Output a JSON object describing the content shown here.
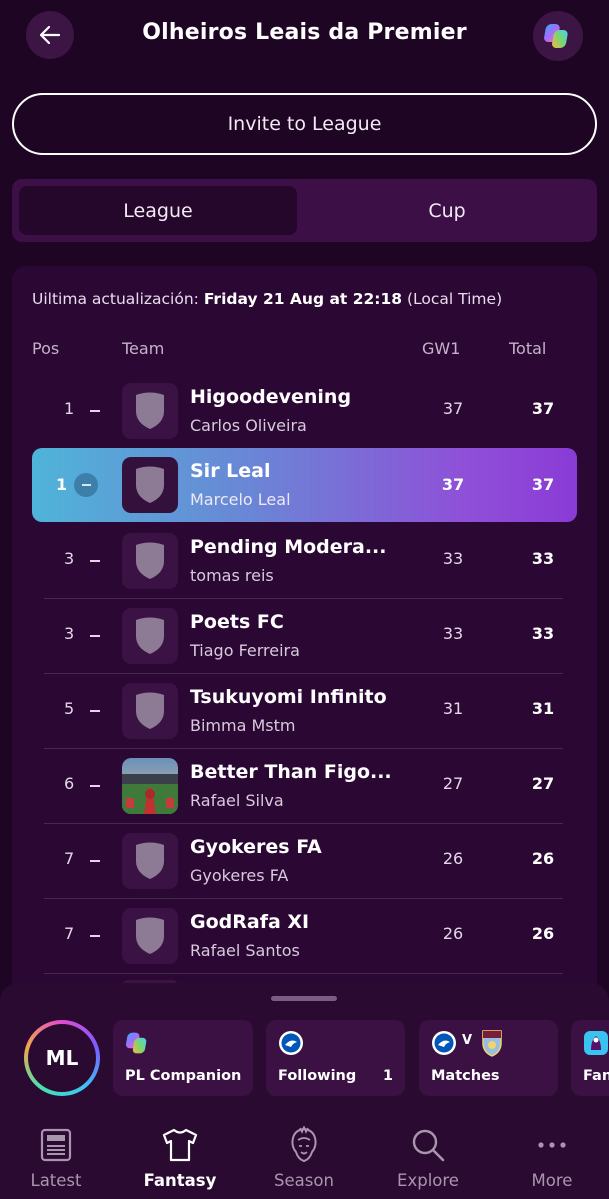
{
  "header": {
    "title": "Olheiros Leais da Premier",
    "back_icon": "arrow-left-icon",
    "assistant_icon": "copilot-icon"
  },
  "invite": {
    "label": "Invite to League"
  },
  "tabs": [
    {
      "label": "League",
      "active": true
    },
    {
      "label": "Cup",
      "active": false
    }
  ],
  "standings": {
    "updated_prefix": "Uiltima actualización: ",
    "updated_value": "Friday 21 Aug at 22:18",
    "updated_suffix": " (Local Time)",
    "columns": {
      "pos": "Pos",
      "team": "Team",
      "gw": "GW1",
      "total": "Total"
    },
    "rows": [
      {
        "pos": "1",
        "team": "Higoodevening",
        "manager": "Carlos Oliveira",
        "gw": "37",
        "total": "37",
        "highlight": false,
        "crest": "shield"
      },
      {
        "pos": "1",
        "team": "Sir Leal",
        "manager": "Marcelo Leal",
        "gw": "37",
        "total": "37",
        "highlight": true,
        "crest": "shield"
      },
      {
        "pos": "3",
        "team": "Pending Modera...",
        "manager": "tomas reis",
        "gw": "33",
        "total": "33",
        "highlight": false,
        "crest": "shield"
      },
      {
        "pos": "3",
        "team": "Poets FC",
        "manager": "Tiago Ferreira",
        "gw": "33",
        "total": "33",
        "highlight": false,
        "crest": "shield"
      },
      {
        "pos": "5",
        "team": "Tsukuyomi Infinito",
        "manager": "Bimma Mstm",
        "gw": "31",
        "total": "31",
        "highlight": false,
        "crest": "shield"
      },
      {
        "pos": "6",
        "team": "Better Than Figo...",
        "manager": "Rafael Silva",
        "gw": "27",
        "total": "27",
        "highlight": false,
        "crest": "photo"
      },
      {
        "pos": "7",
        "team": "Gyokeres FA",
        "manager": "Gyokeres FA",
        "gw": "26",
        "total": "26",
        "highlight": false,
        "crest": "shield"
      },
      {
        "pos": "7",
        "team": "GodRafa XI",
        "manager": "Rafael Santos",
        "gw": "26",
        "total": "26",
        "highlight": false,
        "crest": "shield"
      }
    ]
  },
  "sheet": {
    "avatar_initials": "ML",
    "cards": [
      {
        "label": "PL Companion",
        "icon": "copilot-icon",
        "count": ""
      },
      {
        "label": "Following",
        "icon": "brighton-badge-icon",
        "count": "1"
      },
      {
        "label": "Matches",
        "icon": "match-badges-icon",
        "vs": "V",
        "count": ""
      },
      {
        "label": "Fan",
        "icon": "premier-league-icon",
        "count": ""
      }
    ]
  },
  "nav": [
    {
      "label": "Latest",
      "icon": "newspaper-icon",
      "active": false
    },
    {
      "label": "Fantasy",
      "icon": "shirt-icon",
      "active": true
    },
    {
      "label": "Season",
      "icon": "lion-icon",
      "active": false
    },
    {
      "label": "Explore",
      "icon": "search-icon",
      "active": false
    },
    {
      "label": "More",
      "icon": "more-dots-icon",
      "active": false
    }
  ],
  "colors": {
    "background": "#1e0524",
    "panel": "#2b0833",
    "highlight_start": "#4fb4d8",
    "highlight_end": "#8a3bd6"
  }
}
